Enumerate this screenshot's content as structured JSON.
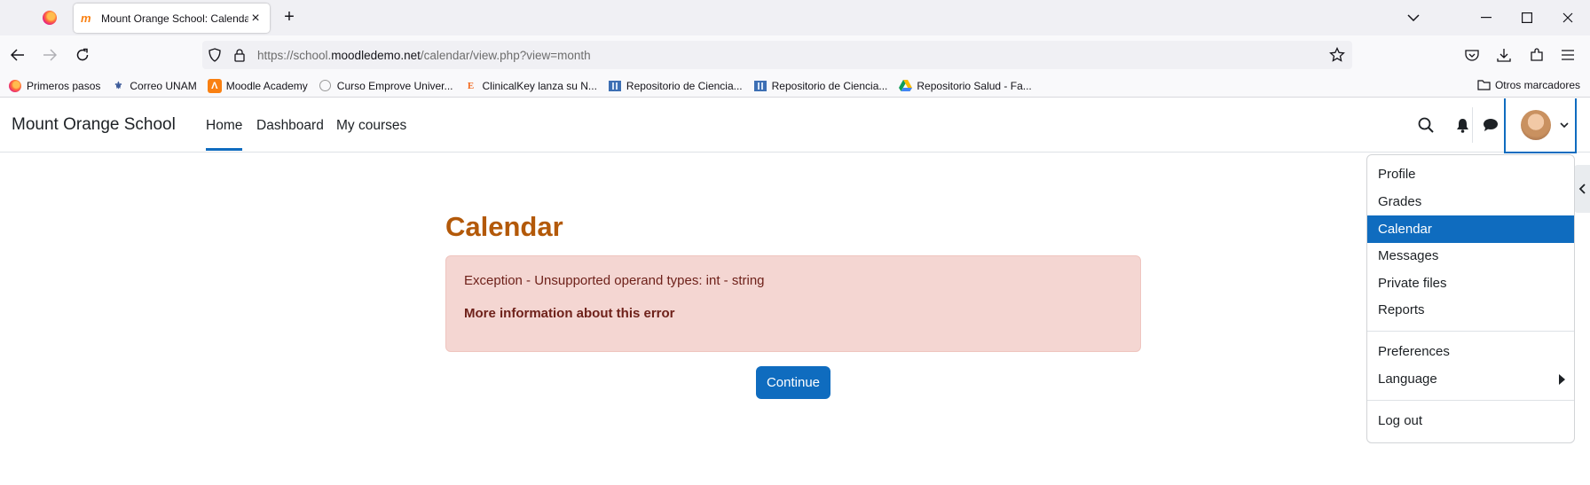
{
  "browser": {
    "tab_title": "Mount Orange School: Calendar",
    "tab_favicon": "m",
    "url_prefix": "https://school.",
    "url_domain": "moodledemo.net",
    "url_path": "/calendar/view.php?view=month",
    "bookmarks": [
      {
        "label": "Primeros pasos",
        "icon": "firefox-icon"
      },
      {
        "label": "Correo UNAM",
        "icon": "unam-icon"
      },
      {
        "label": "Moodle Academy",
        "icon": "moodle-academy-icon"
      },
      {
        "label": "Curso Emprove Univer...",
        "icon": "emprove-icon"
      },
      {
        "label": "ClinicalKey lanza su N...",
        "icon": "elsevier-icon"
      },
      {
        "label": "Repositorio de Ciencia...",
        "icon": "repository-icon"
      },
      {
        "label": "Repositorio de Ciencia...",
        "icon": "repository-icon"
      },
      {
        "label": "Repositorio Salud - Fa...",
        "icon": "google-drive-icon"
      }
    ],
    "other_bookmarks": "Otros marcadores"
  },
  "site": {
    "brand": "Mount Orange School",
    "nav": {
      "home": "Home",
      "dashboard": "Dashboard",
      "my_courses": "My courses"
    }
  },
  "main": {
    "title": "Calendar",
    "error_message": "Exception - Unsupported operand types: int - string",
    "more_info": "More information about this error",
    "continue_label": "Continue"
  },
  "user_menu": {
    "profile": "Profile",
    "grades": "Grades",
    "calendar": "Calendar",
    "messages": "Messages",
    "private_files": "Private files",
    "reports": "Reports",
    "preferences": "Preferences",
    "language": "Language",
    "logout": "Log out",
    "active_item": "Calendar"
  },
  "colors": {
    "accent": "#0f6cbf",
    "title": "#b35909",
    "alert_bg": "#f4d6d2",
    "alert_text": "#6e211a"
  }
}
